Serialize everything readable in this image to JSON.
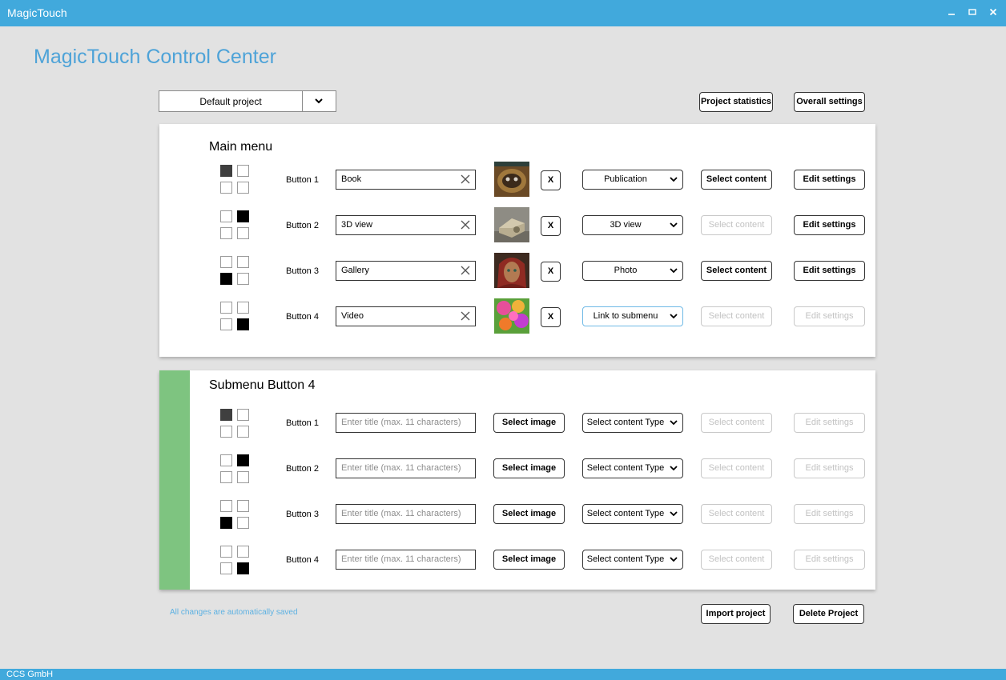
{
  "window": {
    "title": "MagicTouch"
  },
  "header": {
    "page_title": "MagicTouch Control Center"
  },
  "toolbar": {
    "project_select_value": "Default project",
    "project_statistics_label": "Project statistics",
    "overall_settings_label": "Overall settings"
  },
  "main_menu": {
    "title": "Main menu",
    "rows": [
      {
        "label": "Button 1",
        "title_value": "Book",
        "content_type": "Publication",
        "select_content_label": "Select content",
        "select_content_enabled": true,
        "edit_settings_label": "Edit settings",
        "edit_settings_enabled": true,
        "image": "book-cover-thumbnail",
        "remove_label": "X"
      },
      {
        "label": "Button 2",
        "title_value": "3D view",
        "content_type": "3D view",
        "select_content_label": "Select content",
        "select_content_enabled": false,
        "edit_settings_label": "Edit settings",
        "edit_settings_enabled": true,
        "image": "3d-object-thumbnail",
        "remove_label": "X"
      },
      {
        "label": "Button 3",
        "title_value": "Gallery",
        "content_type": "Photo",
        "select_content_label": "Select content",
        "select_content_enabled": true,
        "edit_settings_label": "Edit settings",
        "edit_settings_enabled": true,
        "image": "portrait-photo-thumbnail",
        "remove_label": "X"
      },
      {
        "label": "Button 4",
        "title_value": "Video",
        "content_type": "Link to submenu",
        "select_content_label": "Select content",
        "select_content_enabled": false,
        "edit_settings_label": "Edit settings",
        "edit_settings_enabled": false,
        "image": "colorful-flowers-thumbnail",
        "remove_label": "X"
      }
    ]
  },
  "submenu": {
    "title": "Submenu Button 4",
    "accent_color": "#7ec480",
    "rows": [
      {
        "label": "Button 1",
        "title_placeholder": "Enter title (max. 11 characters)",
        "select_image_label": "Select image",
        "content_type": "Select content Type",
        "select_content_label": "Select content",
        "edit_settings_label": "Edit settings"
      },
      {
        "label": "Button 2",
        "title_placeholder": "Enter title (max. 11 characters)",
        "select_image_label": "Select image",
        "content_type": "Select content Type",
        "select_content_label": "Select content",
        "edit_settings_label": "Edit settings"
      },
      {
        "label": "Button 3",
        "title_placeholder": "Enter title (max. 11 characters)",
        "select_image_label": "Select image",
        "content_type": "Select content Type",
        "select_content_label": "Select content",
        "edit_settings_label": "Edit settings"
      },
      {
        "label": "Button 4",
        "title_placeholder": "Enter title (max. 11 characters)",
        "select_image_label": "Select image",
        "content_type": "Select content Type",
        "select_content_label": "Select content",
        "edit_settings_label": "Edit settings"
      }
    ]
  },
  "footer": {
    "saved_note": "All changes are automatically saved",
    "import_project_label": "Import project",
    "delete_project_label": "Delete Project",
    "company": "CCS GmbH"
  },
  "colors": {
    "titlebar": "#41a9dc",
    "title_text": "#4ea3d8",
    "note_text": "#5db1e2"
  },
  "icons": [
    "minimize-icon",
    "maximize-icon",
    "close-icon",
    "chevron-down-icon",
    "clear-icon",
    "grid-position-icon"
  ]
}
